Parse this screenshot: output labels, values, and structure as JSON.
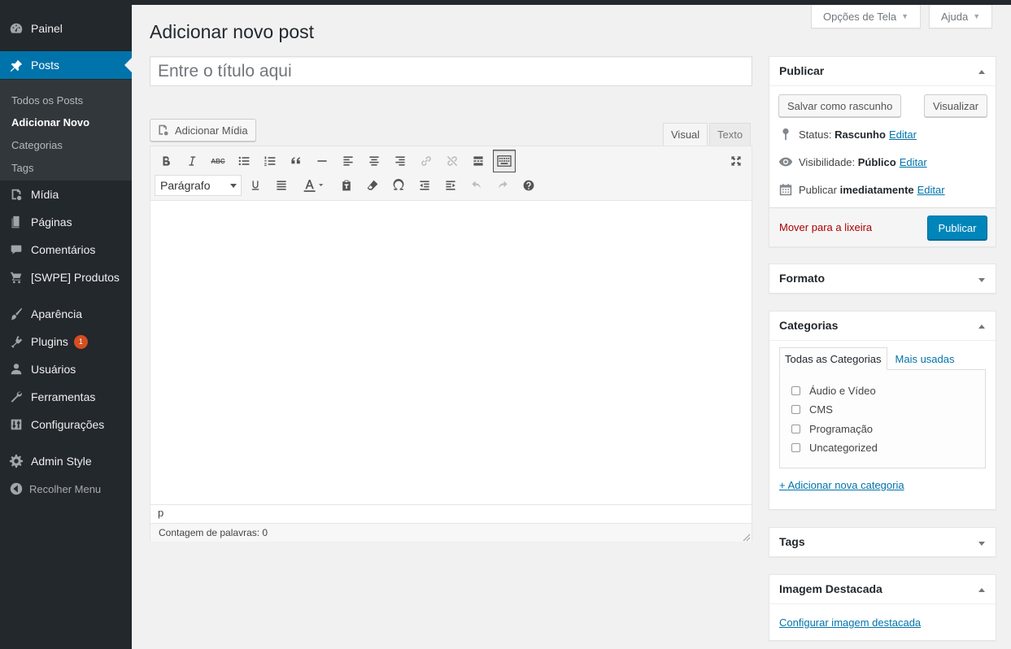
{
  "sidebar": {
    "items": [
      {
        "label": "Painel",
        "icon": "dashboard-icon"
      },
      {
        "label": "Posts",
        "icon": "pin-icon"
      },
      {
        "label": "Mídia",
        "icon": "media-icon"
      },
      {
        "label": "Páginas",
        "icon": "pages-icon"
      },
      {
        "label": "Comentários",
        "icon": "comments-icon"
      },
      {
        "label": "[SWPE] Produtos",
        "icon": "cart-icon"
      },
      {
        "label": "Aparência",
        "icon": "brush-icon"
      },
      {
        "label": "Plugins",
        "icon": "plugin-icon",
        "badge": "1"
      },
      {
        "label": "Usuários",
        "icon": "user-icon"
      },
      {
        "label": "Ferramentas",
        "icon": "wrench-icon"
      },
      {
        "label": "Configurações",
        "icon": "settings-icon"
      },
      {
        "label": "Admin Style",
        "icon": "gear-icon"
      }
    ],
    "submenu": [
      "Todos os Posts",
      "Adicionar Novo",
      "Categorias",
      "Tags"
    ],
    "collapse_label": "Recolher Menu",
    "accent_color": "#0073aa"
  },
  "screen_options": {
    "options_label": "Opções de Tela",
    "help_label": "Ajuda"
  },
  "page_title": "Adicionar novo post",
  "title_placeholder": "Entre o título aqui",
  "editor": {
    "add_media_label": "Adicionar Mídia",
    "tab_visual": "Visual",
    "tab_text": "Texto",
    "format_value": "Parágrafo",
    "path": "p",
    "word_count": "Contagem de palavras: 0"
  },
  "publish_box": {
    "title": "Publicar",
    "save_draft_label": "Salvar como rascunho",
    "preview_label": "Visualizar",
    "status_label": "Status:",
    "status_value": "Rascunho",
    "visibility_label": "Visibilidade:",
    "visibility_value": "Público",
    "publish_label": "Publicar",
    "publish_value": "imediatamente",
    "edit_label": "Editar",
    "trash_label": "Mover para a lixeira",
    "publish_button": "Publicar"
  },
  "format_box": {
    "title": "Formato"
  },
  "categories_box": {
    "title": "Categorias",
    "tab_all": "Todas as Categorias",
    "tab_popular": "Mais usadas",
    "items": [
      "Áudio e Vídeo",
      "CMS",
      "Programação",
      "Uncategorized"
    ],
    "add_new_label": "+ Adicionar nova categoria"
  },
  "tags_box": {
    "title": "Tags"
  },
  "featured_box": {
    "title": "Imagem Destacada",
    "set_label": "Configurar imagem destacada"
  }
}
